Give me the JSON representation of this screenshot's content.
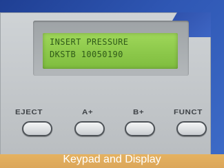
{
  "display": {
    "line1": "INSERT PRESSURE",
    "line2": "DKSTB 10050190"
  },
  "keys": [
    {
      "label": "EJECT"
    },
    {
      "label": "A+"
    },
    {
      "label": "B+"
    },
    {
      "label": "FUNCT"
    }
  ],
  "caption": "Keypad and Display",
  "colors": {
    "lcd": "#8cc84a",
    "lcd_text": "#2f5a18",
    "panel": "#c5c9cc",
    "background": "#2f57b4",
    "caption_bar": "#dba65a"
  }
}
